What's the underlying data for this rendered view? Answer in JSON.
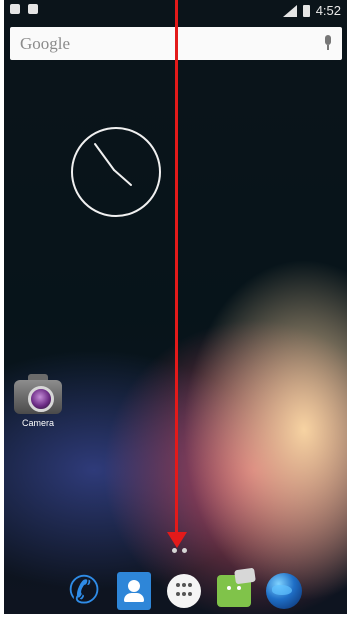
{
  "status_bar": {
    "time": "4:52",
    "left_icons": [
      "sim-icon",
      "android-icon"
    ],
    "right_icons": [
      "signal-icon",
      "battery-icon"
    ]
  },
  "search": {
    "label": "Google",
    "mic_icon": "mic-icon"
  },
  "clock": {
    "hour_angle_deg": -35,
    "minute_angle_deg": 145
  },
  "apps": [
    {
      "label": "Camera",
      "icon": "camera-icon"
    }
  ],
  "overlay": {
    "arrow_color": "#e31a1a",
    "arrow_direction": "down"
  },
  "page_indicator": {
    "count": 2
  },
  "dock": [
    {
      "name": "phone-icon"
    },
    {
      "name": "contacts-icon"
    },
    {
      "name": "apps-drawer-icon"
    },
    {
      "name": "messaging-icon"
    },
    {
      "name": "browser-icon"
    }
  ],
  "colors": {
    "accent": "#2f8ce7",
    "arrow": "#e31a1a"
  }
}
